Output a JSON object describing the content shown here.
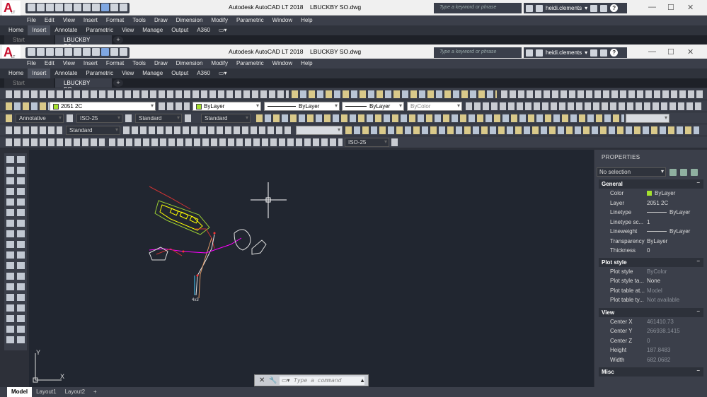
{
  "app": {
    "window_title": "Autodesk AutoCAD LT 2018",
    "file_name": "LBUCKBY SO.dwg",
    "logo_sub": "LT"
  },
  "search": {
    "placeholder": "Type a keyword or phrase"
  },
  "user": {
    "name": "heidi.clements"
  },
  "menu": [
    "File",
    "Edit",
    "View",
    "Insert",
    "Format",
    "Tools",
    "Draw",
    "Dimension",
    "Modify",
    "Parametric",
    "Window",
    "Help"
  ],
  "ribbon_tabs": [
    "Home",
    "Insert",
    "Annotate",
    "Parametric",
    "View",
    "Manage",
    "Output",
    "A360"
  ],
  "file_tabs": [
    "Start",
    "LBUCKBY SO"
  ],
  "toolbar": {
    "layer_value": "2051 2C",
    "color_value": "ByLayer",
    "linetype_value": "ByLayer",
    "lineweight_value": "ByLayer",
    "plotstyle_value": "ByColor",
    "annotative": "Annotative",
    "dimstyle": "ISO-25",
    "textstyle": "Standard",
    "tablestyle": "Standard",
    "mleaderstyle": "Standard",
    "dimstyle2": "ISO-25"
  },
  "properties": {
    "title": "PROPERTIES",
    "selection": "No selection",
    "general": {
      "label": "General",
      "rows": [
        {
          "k": "Color",
          "v": "ByLayer"
        },
        {
          "k": "Layer",
          "v": "2051 2C"
        },
        {
          "k": "Linetype",
          "v": "ByLayer"
        },
        {
          "k": "Linetype sc...",
          "v": "1"
        },
        {
          "k": "Lineweight",
          "v": "ByLayer"
        },
        {
          "k": "Transparency",
          "v": "ByLayer"
        },
        {
          "k": "Thickness",
          "v": "0"
        }
      ]
    },
    "plot_style": {
      "label": "Plot style",
      "rows": [
        {
          "k": "Plot style",
          "v": "ByColor"
        },
        {
          "k": "Plot style ta...",
          "v": "None"
        },
        {
          "k": "Plot table at...",
          "v": "Model"
        },
        {
          "k": "Plot table ty...",
          "v": "Not available"
        }
      ]
    },
    "view": {
      "label": "View",
      "rows": [
        {
          "k": "Center X",
          "v": "461410.73"
        },
        {
          "k": "Center Y",
          "v": "266938.1415"
        },
        {
          "k": "Center Z",
          "v": "0"
        },
        {
          "k": "Height",
          "v": "187.8483"
        },
        {
          "k": "Width",
          "v": "682.0682"
        }
      ]
    },
    "misc": {
      "label": "Misc"
    }
  },
  "command": {
    "placeholder": "Type a command"
  },
  "layout_tabs": [
    "Model",
    "Layout1",
    "Layout2"
  ],
  "canvas": {
    "ucs_x": "X",
    "ucs_y": "Y",
    "drawing_label": "4x3"
  }
}
